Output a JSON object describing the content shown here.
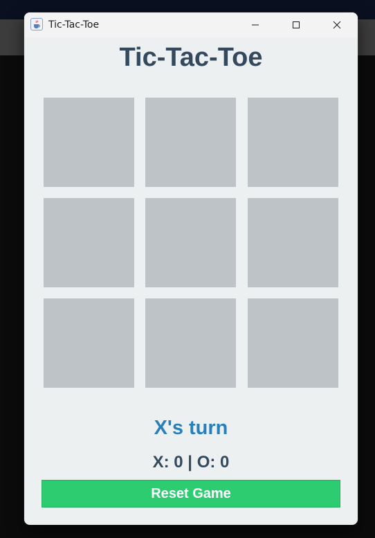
{
  "window": {
    "title": "Tic-Tac-Toe",
    "app_icon": "java-cup-icon",
    "controls": {
      "minimize_icon": "minimize-icon",
      "maximize_icon": "maximize-icon",
      "close_icon": "close-icon"
    }
  },
  "game": {
    "title": "Tic-Tac-Toe",
    "board": [
      "",
      "",
      "",
      "",
      "",
      "",
      "",
      "",
      ""
    ],
    "status": "X's turn",
    "score": "X: 0 | O: 0",
    "reset_label": "Reset Game"
  },
  "colors": {
    "window_bg": "#ecf0f1",
    "title": "#34495e",
    "cell": "#bdc3c7",
    "status": "#2980b9",
    "score": "#34495e",
    "reset_button": "#2ecc71"
  }
}
